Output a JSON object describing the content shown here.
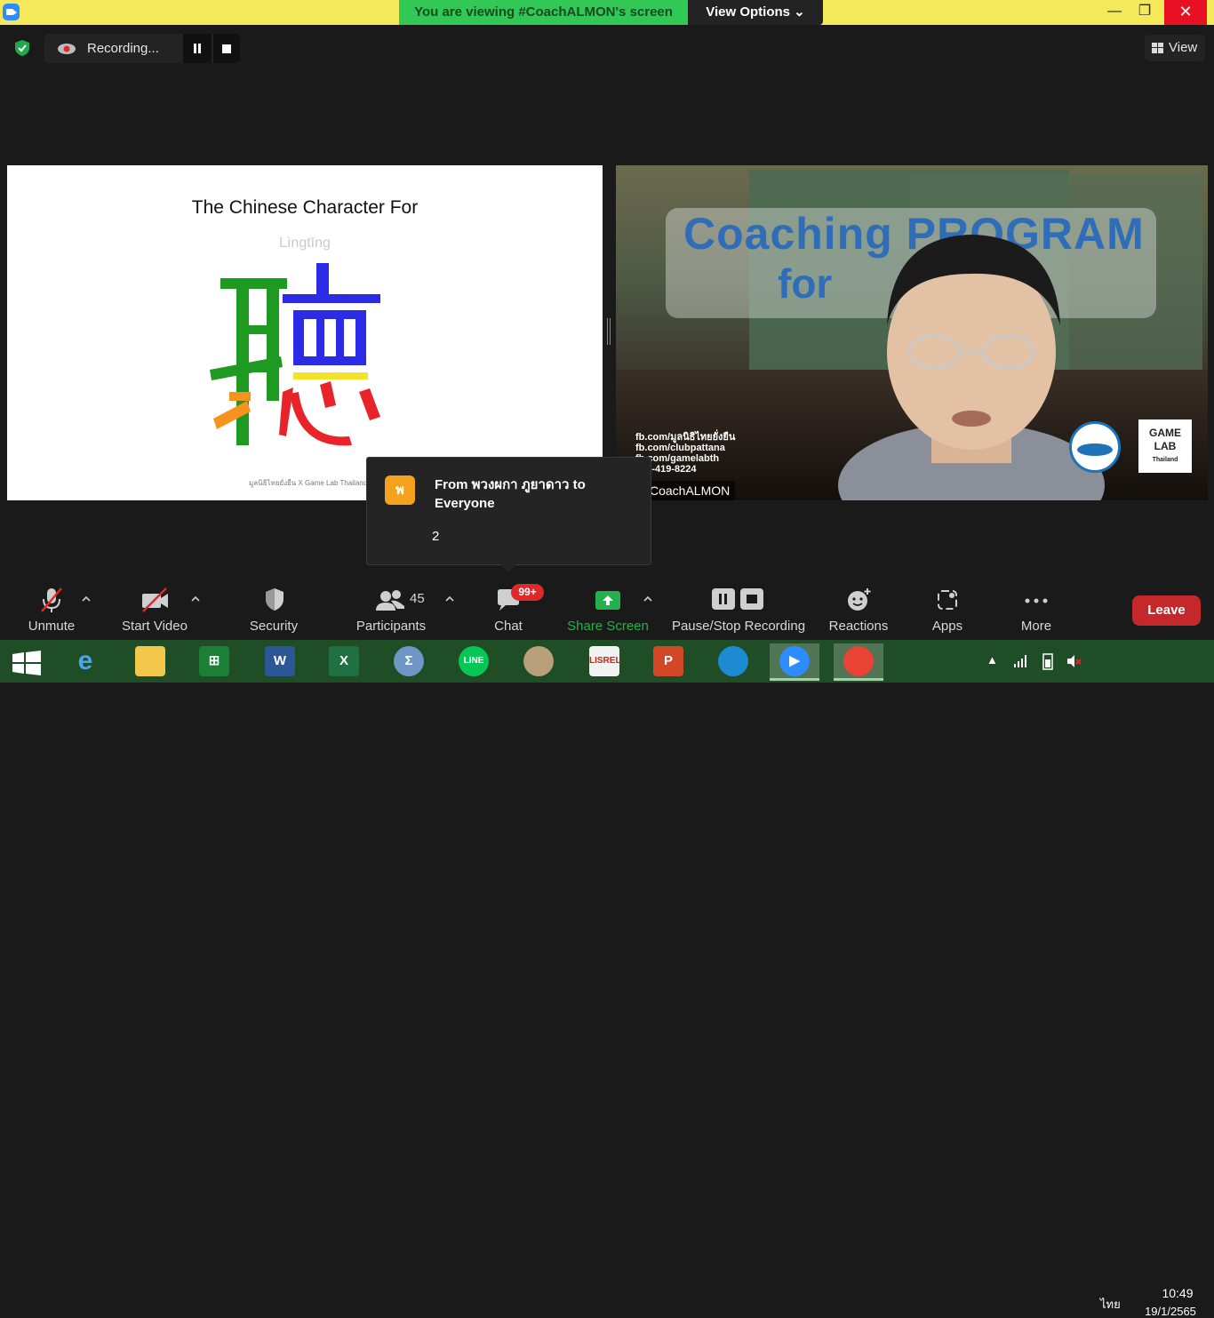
{
  "window": {
    "banner": "You are viewing #CoachALMON's screen",
    "view_options": "View Options",
    "controls": [
      "minimize-icon",
      "maximize-icon",
      "close-icon"
    ]
  },
  "recording": {
    "label": "Recording..."
  },
  "view_button": {
    "label": "View"
  },
  "slide": {
    "title": "The Chinese Character For",
    "subtitle": "Lìngtīng",
    "character": "聽",
    "footer": "มูลนิธิไทยยั่งยืน X Game Lab Thailand"
  },
  "camera": {
    "overlay_line1": "Coaching PROGRAM",
    "overlay_line2": "for",
    "contacts": [
      "fb.com/มูลนิธิไทยยั่งยืน",
      "fb.com/clubpattana",
      "fb.com/gamelabth",
      "080-419-8224"
    ],
    "logo_text": "GAME LAB",
    "logo_sub": "Thailand",
    "participant_name": "CoachALMON"
  },
  "chat_popup": {
    "avatar_initial": "พ",
    "from": "From พวงผกา ภูยาดาว to Everyone",
    "message": "2"
  },
  "toolbar": {
    "unmute": "Unmute",
    "start_video": "Start Video",
    "security": "Security",
    "participants": "Participants",
    "participants_count": "45",
    "chat": "Chat",
    "chat_badge": "99+",
    "share_screen": "Share Screen",
    "pause_stop_recording": "Pause/Stop Recording",
    "reactions": "Reactions",
    "apps": "Apps",
    "more": "More",
    "leave": "Leave"
  },
  "taskbar": {
    "apps": [
      "Windows Start",
      "Internet Explorer",
      "File Explorer",
      "Microsoft Store",
      "Word",
      "Excel",
      "Math Input Panel",
      "LINE",
      "Paint",
      "LISREL",
      "PowerPoint",
      "Edge",
      "Zoom",
      "Chrome"
    ],
    "language": "ไทย",
    "time": "10:49",
    "date": "19/1/2565"
  },
  "colors": {
    "banner": "#f3e95a",
    "viewing_green": "#32c856",
    "leave_red": "#c5282a",
    "share_green": "#24b14d",
    "taskbar": "#1f4d25"
  }
}
